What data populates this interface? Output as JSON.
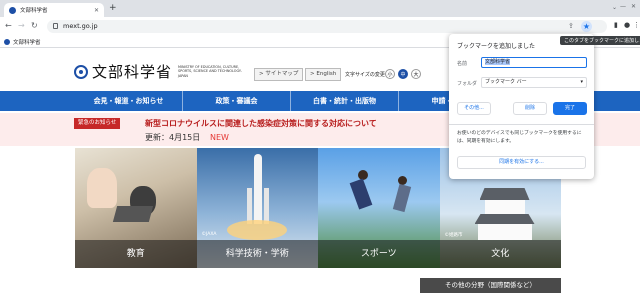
{
  "browser": {
    "tab_title": "文部科学省",
    "tab_close": "✕",
    "new_tab": "+",
    "url": "mext.go.jp",
    "tooltip": "このタブをブックマークに追加します",
    "bookmarks_bar": [
      {
        "label": "文部科学省"
      }
    ]
  },
  "header": {
    "logo_text": "文部科学省",
    "logo_sub": "MINISTRY OF EDUCATION, CULTURE, SPORTS, SCIENCE AND TECHNOLOGY-JAPAN",
    "sitemap": "> サイトマップ",
    "english": "> English",
    "font_size_label": "文字サイズの変更",
    "font_sizes": [
      "小",
      "中",
      "大"
    ]
  },
  "global_nav": [
    "会見・報道・お知らせ",
    "政策・審議会",
    "白書・統計・出版物",
    "申請・手続き"
  ],
  "alert": {
    "badge": "緊急のお知らせ",
    "title": "新型コロナウイルスに関連した感染症対策に関する対応について",
    "date": "更新：4月15日",
    "new": "NEW"
  },
  "photos": [
    {
      "label": "教育",
      "credit": ""
    },
    {
      "label": "科学技術・学術",
      "credit": "©JAXA"
    },
    {
      "label": "スポーツ",
      "credit": ""
    },
    {
      "label": "文化",
      "credit": "©姫路市"
    }
  ],
  "other_fields": "その他の分野（国際関係など）",
  "bookmark_popup": {
    "title": "ブックマークを追加しました",
    "name_label": "名前",
    "name_value": "文部科学省",
    "folder_label": "フォルダ",
    "folder_value": "ブックマーク バー",
    "more": "その他...",
    "delete": "削除",
    "done": "完了",
    "sync_text": "お使いのどのデバイスでも同じブックマークを使用するには、同期を有効にします。",
    "sync_button": "同期を有効にする..."
  },
  "colors": {
    "nav_blue": "#1d64c0",
    "alert_red": "#c62828",
    "chrome_blue": "#1a73e8"
  }
}
